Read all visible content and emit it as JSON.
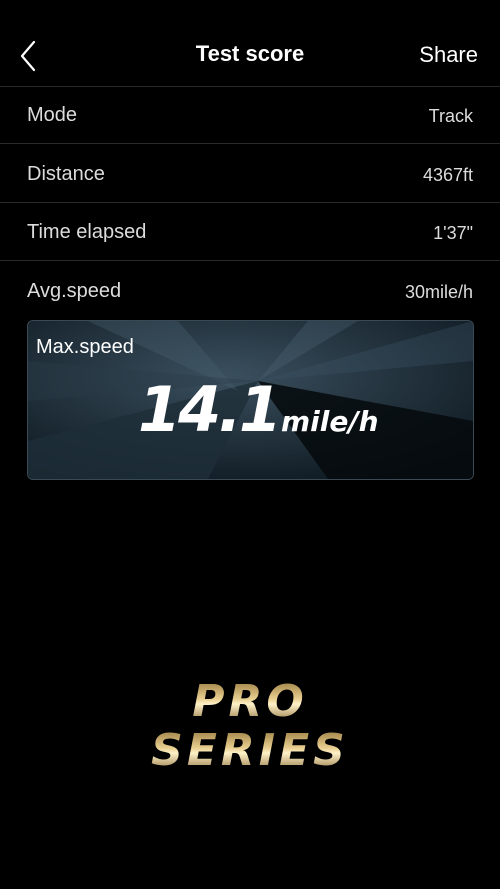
{
  "header": {
    "title": "Test score",
    "share_label": "Share"
  },
  "rows": [
    {
      "label": "Mode",
      "value": "Track"
    },
    {
      "label": "Distance",
      "value": "4367ft"
    },
    {
      "label": "Time elapsed",
      "value": "1'37\""
    },
    {
      "label": "Avg.speed",
      "value": "30mile/h"
    }
  ],
  "max_speed": {
    "label": "Max.speed",
    "number": "14.1",
    "unit": "mile/h"
  },
  "logo": {
    "line1": "PRO",
    "line2": "SERIES"
  },
  "colors": {
    "background": "#000000",
    "card": "#0e1a22",
    "logo_gold": "#c9a35a"
  }
}
